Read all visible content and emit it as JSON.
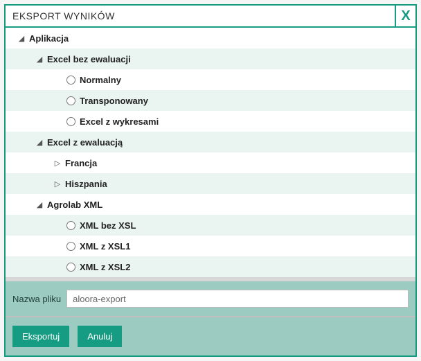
{
  "title": "EKSPORT WYNIKÓW",
  "close_label": "X",
  "tree": {
    "root": {
      "label": "Aplikacja",
      "expanded": true
    },
    "excel_no_eval": {
      "label": "Excel bez ewaluacji",
      "opts": {
        "normal": "Normalny",
        "transposed": "Transponowany",
        "charts": "Excel z wykresami"
      }
    },
    "excel_eval": {
      "label": "Excel z ewaluacją",
      "france": "Francja",
      "spain": "Hiszpania"
    },
    "agrolab": {
      "label": "Agrolab XML",
      "opts": {
        "noxsl": "XML bez XSL",
        "xsl1": "XML z XSL1",
        "xsl2": "XML z XSL2"
      }
    }
  },
  "filename_label": "Nazwa pliku",
  "filename_value": "aloora-export",
  "buttons": {
    "export": "Eksportuj",
    "cancel": "Anuluj"
  }
}
